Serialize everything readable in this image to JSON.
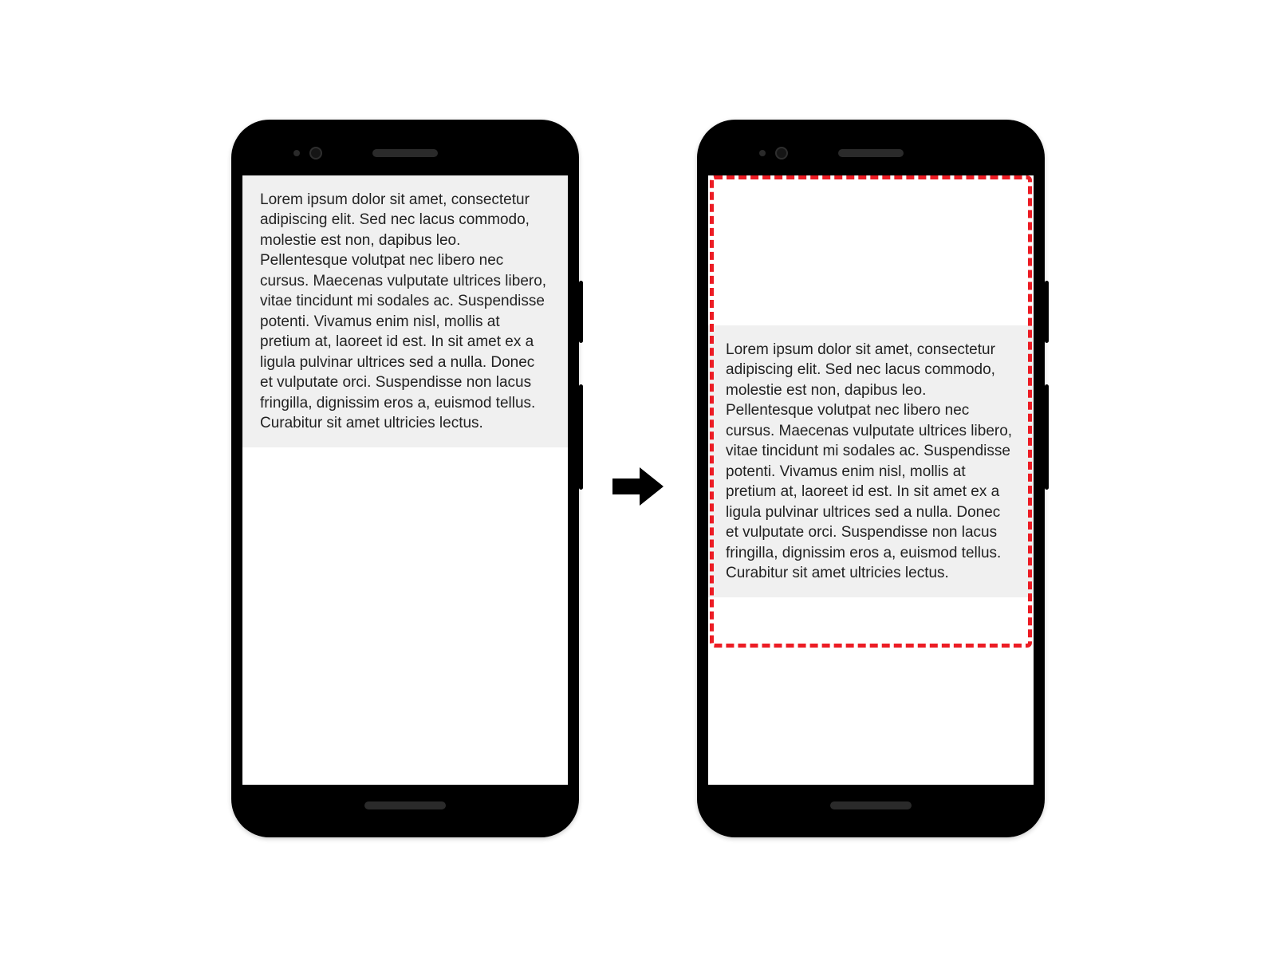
{
  "left_phone": {
    "body_text": "Lorem ipsum dolor sit amet, consectetur adipiscing elit. Sed nec lacus commodo, molestie est non, dapibus leo. Pellentesque volutpat nec libero nec cursus. Maecenas vulputate ultrices libero, vitae tincidunt mi sodales ac. Suspendisse potenti. Vivamus enim nisl, mollis at pretium at, laoreet id est. In sit amet ex a ligula pulvinar ultrices sed a nulla. Donec et vulputate orci. Suspendisse non lacus fringilla, dignissim eros a, euismod tellus. Curabitur sit amet ultricies lectus."
  },
  "right_phone": {
    "body_text": "Lorem ipsum dolor sit amet, consectetur adipiscing elit. Sed nec lacus commodo, molestie est non, dapibus leo. Pellentesque volutpat nec libero nec cursus. Maecenas vulputate ultrices libero, vitae tincidunt mi sodales ac. Suspendisse potenti. Vivamus enim nisl, mollis at pretium at, laoreet id est. In sit amet ex a ligula pulvinar ultrices sed a nulla. Donec et vulputate orci. Suspendisse non lacus fringilla, dignissim eros a, euismod tellus. Curabitur sit amet ultricies lectus."
  },
  "highlight_color": "#ec1c24"
}
